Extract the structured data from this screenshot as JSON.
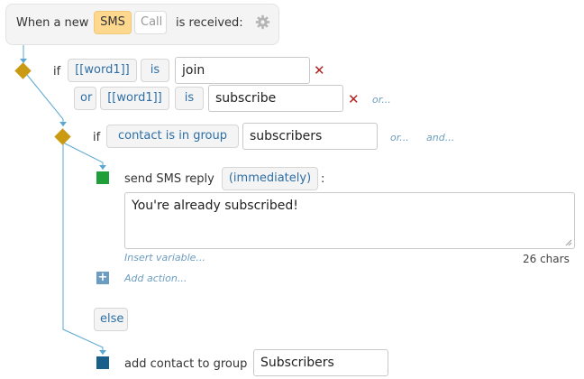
{
  "trigger": {
    "prefix": "When a new",
    "sms_label": "SMS",
    "call_label": "Call",
    "suffix": "is received:",
    "settings_icon": "gear-icon"
  },
  "condition1": {
    "if_label": "if",
    "var_label": "[[word1]]",
    "op_label": "is",
    "value": "join",
    "or_label": "or",
    "or_var_label": "[[word1]]",
    "or_op_label": "is",
    "or_value": "subscribe",
    "or_more_link": "or..."
  },
  "condition2": {
    "if_label": "if",
    "cond_label": "contact is in group",
    "value": "subscribers",
    "or_link": "or...",
    "and_link": "and..."
  },
  "action_reply": {
    "label": "send SMS reply",
    "timing_label": "(immediately)",
    "colon": ":",
    "message": "You're already subscribed!",
    "insert_variable_link": "Insert variable...",
    "char_count": "26 chars"
  },
  "add_action_link": "Add action...",
  "else_label": "else",
  "action_group": {
    "label": "add contact to group",
    "value": "Subscribers"
  },
  "colors": {
    "condition_node": "#c99a12",
    "reply_node": "#1f9e3a",
    "group_node": "#1a5f8a",
    "connector": "#5aa7d1",
    "remove_mark": "#b22222"
  }
}
